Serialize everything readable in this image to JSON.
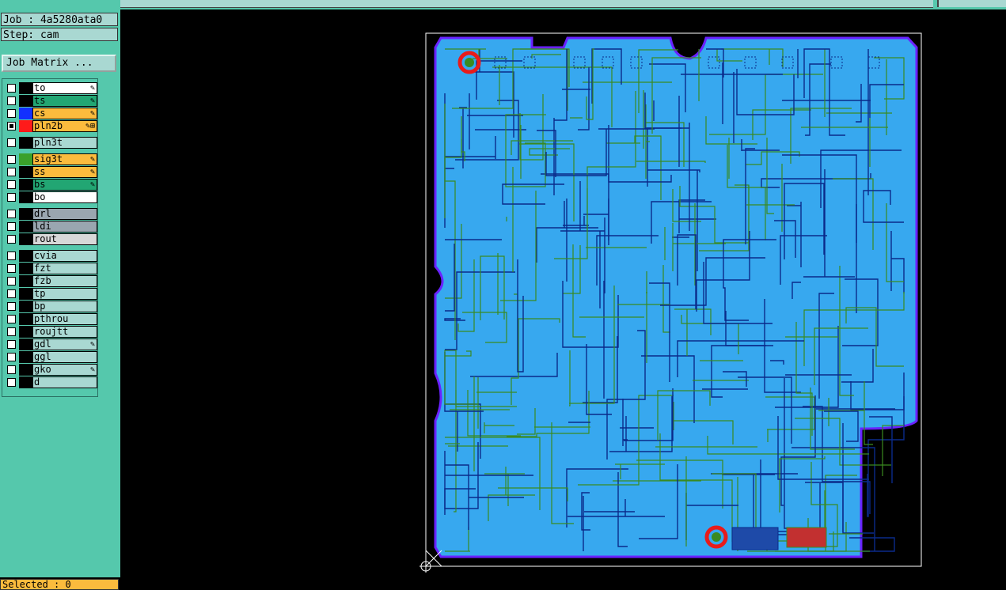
{
  "job": "Job : 4a5280ata0",
  "step": "Step: cam",
  "job_matrix_button": "Job Matrix ...",
  "layers": [
    {
      "name": "to",
      "checked": false,
      "swatch": "#000000",
      "bg": "#ffffff",
      "marker": "✎"
    },
    {
      "name": "ts",
      "checked": false,
      "swatch": "#000000",
      "bg": "#22a673",
      "marker": "✎"
    },
    {
      "name": "cs",
      "checked": false,
      "swatch": "#1230ff",
      "bg": "#fbbb3d",
      "marker": "✎"
    },
    {
      "name": "pln2b",
      "checked": true,
      "swatch": "#ff1a1a",
      "bg": "#fbbb3d",
      "marker": "✎⊞"
    },
    {
      "name": "pln3t",
      "checked": false,
      "swatch": "#000000",
      "bg": "#a9d8d2",
      "marker": ""
    },
    {
      "name": "sig3t",
      "checked": false,
      "swatch": "#3aa02a",
      "bg": "#fbbb3d",
      "marker": "✎"
    },
    {
      "name": "ss",
      "checked": false,
      "swatch": "#000000",
      "bg": "#fbbb3d",
      "marker": "✎"
    },
    {
      "name": "bs",
      "checked": false,
      "swatch": "#000000",
      "bg": "#22a673",
      "marker": "✎"
    },
    {
      "name": "bo",
      "checked": false,
      "swatch": "#000000",
      "bg": "#ffffff",
      "marker": ""
    },
    {
      "name": "drl",
      "checked": false,
      "swatch": "#000000",
      "bg": "#9aa6b0",
      "marker": ""
    },
    {
      "name": "ldi",
      "checked": false,
      "swatch": "#000000",
      "bg": "#9aa6b0",
      "marker": ""
    },
    {
      "name": "rout",
      "checked": false,
      "swatch": "#000000",
      "bg": "#d8d8d8",
      "marker": ""
    },
    {
      "name": "cvia",
      "checked": false,
      "swatch": "#000000",
      "bg": "#a9d8d2",
      "marker": ""
    },
    {
      "name": "fzt",
      "checked": false,
      "swatch": "#000000",
      "bg": "#a9d8d2",
      "marker": ""
    },
    {
      "name": "fzb",
      "checked": false,
      "swatch": "#000000",
      "bg": "#a9d8d2",
      "marker": ""
    },
    {
      "name": "tp",
      "checked": false,
      "swatch": "#000000",
      "bg": "#a9d8d2",
      "marker": ""
    },
    {
      "name": "bp",
      "checked": false,
      "swatch": "#000000",
      "bg": "#a9d8d2",
      "marker": ""
    },
    {
      "name": "pthrou",
      "checked": false,
      "swatch": "#000000",
      "bg": "#a9d8d2",
      "marker": ""
    },
    {
      "name": "roujtt",
      "checked": false,
      "swatch": "#000000",
      "bg": "#a9d8d2",
      "marker": ""
    },
    {
      "name": "gdl",
      "checked": false,
      "swatch": "#000000",
      "bg": "#a9d8d2",
      "marker": "✎"
    },
    {
      "name": "ggl",
      "checked": false,
      "swatch": "#000000",
      "bg": "#a9d8d2",
      "marker": ""
    },
    {
      "name": "gko",
      "checked": false,
      "swatch": "#000000",
      "bg": "#a9d8d2",
      "marker": "✎"
    },
    {
      "name": "d",
      "checked": false,
      "swatch": "#000000",
      "bg": "#a9d8d2",
      "marker": ""
    }
  ],
  "status": "Selected : 0",
  "colors": {
    "board": "#37a8ef",
    "outline": "#6a22ff",
    "trace_dark": "#0a2a8a",
    "trace_green": "#3a8a20",
    "pad_red": "#e81b1b",
    "frame": "#ffffff"
  }
}
